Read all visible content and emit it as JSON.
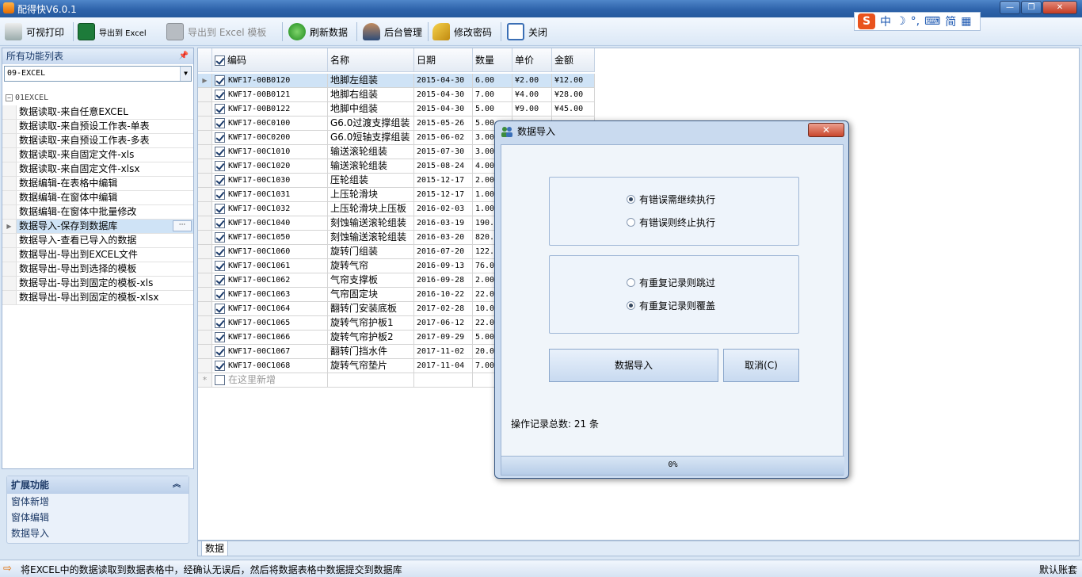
{
  "window": {
    "title": "配得快V6.0.1"
  },
  "ime": {
    "logo": "S",
    "items": [
      "中",
      "☽",
      "°,",
      "⌨",
      "简",
      "▦"
    ]
  },
  "toolbar": {
    "print": "可视打印",
    "export_excel": "导出到 Excel",
    "export_template": "导出到 Excel 模板",
    "refresh": "刷新数据",
    "admin": "后台管理",
    "change_password": "修改密码",
    "close": "关闭"
  },
  "sidebar": {
    "header": "所有功能列表",
    "pin": "ㅁ",
    "combo_value": "09-EXCEL",
    "group": "01EXCEL",
    "items": [
      {
        "label": "数据读取-来自任意EXCEL",
        "selected": false
      },
      {
        "label": "数据读取-来自预设工作表-单表",
        "selected": false
      },
      {
        "label": "数据读取-来自预设工作表-多表",
        "selected": false
      },
      {
        "label": "数据读取-来自固定文件-xls",
        "selected": false
      },
      {
        "label": "数据读取-来自固定文件-xlsx",
        "selected": false
      },
      {
        "label": "数据编辑-在表格中编辑",
        "selected": false
      },
      {
        "label": "数据编辑-在窗体中编辑",
        "selected": false
      },
      {
        "label": "数据编辑-在窗体中批量修改",
        "selected": false
      },
      {
        "label": "数据导入-保存到数据库",
        "selected": true
      },
      {
        "label": "数据导入-查看已导入的数据",
        "selected": false
      },
      {
        "label": "数据导出-导出到EXCEL文件",
        "selected": false
      },
      {
        "label": "数据导出-导出到选择的模板",
        "selected": false
      },
      {
        "label": "数据导出-导出到固定的模板-xls",
        "selected": false
      },
      {
        "label": "数据导出-导出到固定的模板-xlsx",
        "selected": false
      }
    ],
    "more_button": "···"
  },
  "expand_panel": {
    "title": "扩展功能",
    "items": [
      "窗体新增",
      "窗体编辑",
      "数据导入"
    ]
  },
  "grid": {
    "columns": [
      "编码",
      "名称",
      "日期",
      "数量",
      "单价",
      "金额"
    ],
    "rows": [
      {
        "code": "KWF17-00B0120",
        "name": "地脚左组装",
        "date": "2015-04-30",
        "qty": "6.00",
        "price": "¥2.00",
        "amount": "¥12.00"
      },
      {
        "code": "KWF17-00B0121",
        "name": "地脚右组装",
        "date": "2015-04-30",
        "qty": "7.00",
        "price": "¥4.00",
        "amount": "¥28.00"
      },
      {
        "code": "KWF17-00B0122",
        "name": "地脚中组装",
        "date": "2015-04-30",
        "qty": "5.00",
        "price": "¥9.00",
        "amount": "¥45.00"
      },
      {
        "code": "KWF17-00C0100",
        "name": "G6.0过渡支撑组装",
        "date": "2015-05-26",
        "qty": "5.00",
        "price": "",
        "amount": ""
      },
      {
        "code": "KWF17-00C0200",
        "name": "G6.0短轴支撑组装",
        "date": "2015-06-02",
        "qty": "3.00",
        "price": "",
        "amount": ""
      },
      {
        "code": "KWF17-00C1010",
        "name": "输送滚轮组装",
        "date": "2015-07-30",
        "qty": "3.00",
        "price": "",
        "amount": ""
      },
      {
        "code": "KWF17-00C1020",
        "name": "输送滚轮组装",
        "date": "2015-08-24",
        "qty": "4.00",
        "price": "",
        "amount": ""
      },
      {
        "code": "KWF17-00C1030",
        "name": "压轮组装",
        "date": "2015-12-17",
        "qty": "2.00",
        "price": "",
        "amount": ""
      },
      {
        "code": "KWF17-00C1031",
        "name": "上压轮滑块",
        "date": "2015-12-17",
        "qty": "1.00",
        "price": "",
        "amount": ""
      },
      {
        "code": "KWF17-00C1032",
        "name": "上压轮滑块上压板",
        "date": "2016-02-03",
        "qty": "1.00",
        "price": "",
        "amount": ""
      },
      {
        "code": "KWF17-00C1040",
        "name": "刻蚀输送滚轮组装",
        "date": "2016-03-19",
        "qty": "190.",
        "price": "",
        "amount": ""
      },
      {
        "code": "KWF17-00C1050",
        "name": "刻蚀输送滚轮组装",
        "date": "2016-03-20",
        "qty": "820.",
        "price": "",
        "amount": ""
      },
      {
        "code": "KWF17-00C1060",
        "name": "旋转门组装",
        "date": "2016-07-20",
        "qty": "122.",
        "price": "",
        "amount": ""
      },
      {
        "code": "KWF17-00C1061",
        "name": "旋转气帘",
        "date": "2016-09-13",
        "qty": "76.0",
        "price": "",
        "amount": ""
      },
      {
        "code": "KWF17-00C1062",
        "name": "气帘支撑板",
        "date": "2016-09-28",
        "qty": "2.00",
        "price": "",
        "amount": ""
      },
      {
        "code": "KWF17-00C1063",
        "name": "气帘固定块",
        "date": "2016-10-22",
        "qty": "22.0",
        "price": "",
        "amount": ""
      },
      {
        "code": "KWF17-00C1064",
        "name": "翻转门安装底板",
        "date": "2017-02-28",
        "qty": "10.0",
        "price": "",
        "amount": ""
      },
      {
        "code": "KWF17-00C1065",
        "name": "旋转气帘护板1",
        "date": "2017-06-12",
        "qty": "22.0",
        "price": "",
        "amount": ""
      },
      {
        "code": "KWF17-00C1066",
        "name": "旋转气帘护板2",
        "date": "2017-09-29",
        "qty": "5.00",
        "price": "",
        "amount": ""
      },
      {
        "code": "KWF17-00C1067",
        "name": "翻转门挡水件",
        "date": "2017-11-02",
        "qty": "20.0",
        "price": "",
        "amount": ""
      },
      {
        "code": "KWF17-00C1068",
        "name": "旋转气帘垫片",
        "date": "2017-11-04",
        "qty": "7.00",
        "price": "",
        "amount": ""
      }
    ],
    "new_row_placeholder": "在这里新增",
    "tab": "数据"
  },
  "dialog": {
    "title": "数据导入",
    "close": "✕",
    "error_options": [
      {
        "label": "有错误需继续执行",
        "checked": true
      },
      {
        "label": "有错误则终止执行",
        "checked": false
      }
    ],
    "dup_options": [
      {
        "label": "有重复记录则跳过",
        "checked": false
      },
      {
        "label": "有重复记录则覆盖",
        "checked": true
      }
    ],
    "import_button": "数据导入",
    "cancel_button": "取消(C)",
    "count_text": "操作记录总数: 21 条",
    "progress_text": "0%",
    "progress": 0
  },
  "status": {
    "message": "将EXCEL中的数据读取到数据表格中，经确认无误后，然后将数据表格中数据提交到数据库",
    "user": "默认账套"
  }
}
